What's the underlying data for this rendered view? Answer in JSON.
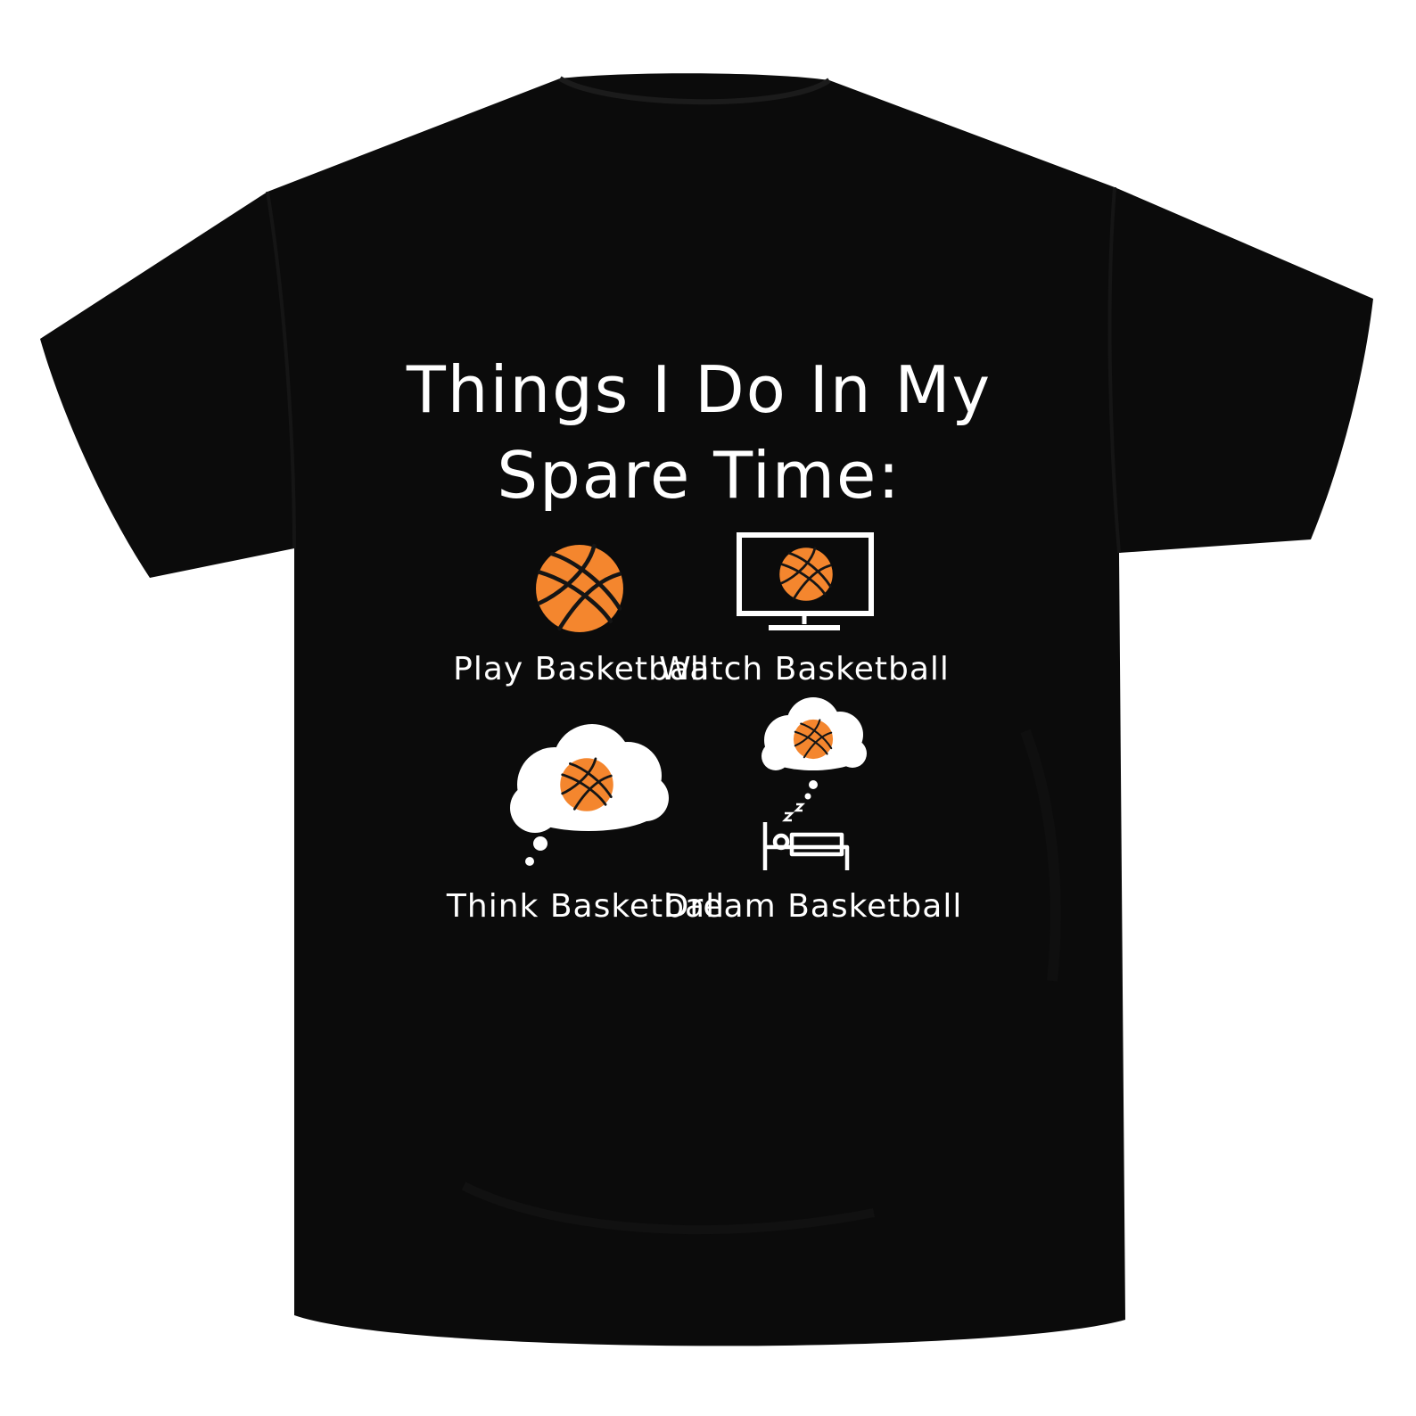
{
  "design": {
    "title_lines": [
      "Things I Do In My",
      "Spare Time:"
    ],
    "panels": [
      {
        "label": "Play Basketball",
        "icon": "basketball-icon"
      },
      {
        "label": "Watch Basketball",
        "icon": "tv-basketball-icon"
      },
      {
        "label": "Think Basketball",
        "icon": "thought-cloud-basketball-icon"
      },
      {
        "label": "Dream Basketball",
        "icon": "sleeping-bed-dream-icon"
      }
    ]
  },
  "colors": {
    "shirt": "#0b0b0b",
    "ink": "#ffffff",
    "ball": "#f4862e",
    "ball_lines": "#151515",
    "background": "#ffffff"
  }
}
